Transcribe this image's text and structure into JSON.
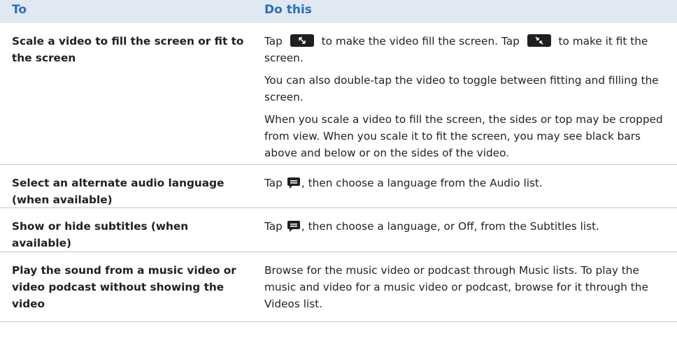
{
  "header": {
    "col_to": "To",
    "col_do": "Do this"
  },
  "rows": [
    {
      "to": "Scale a video to fill the screen or fit to the screen",
      "p1_a": "Tap",
      "p1_b": "to make the video fill the screen. Tap",
      "p1_c": "to make it fit the screen.",
      "p2": "You can also double-tap the video to toggle between fitting and filling the screen.",
      "p3": "When you scale a video to fill the screen, the sides or top may be cropped from view. When you scale it to fit the screen, you may see black bars above and below or on the sides of the video."
    },
    {
      "to": "Select an alternate audio language (when available)",
      "p1_a": "Tap",
      "p1_b": ", then choose a language from the Audio list."
    },
    {
      "to": "Show or hide subtitles (when available)",
      "p1_a": "Tap",
      "p1_b": ", then choose a language, or Off, from the Subtitles list."
    },
    {
      "to": "Play the sound from a music video or video podcast without showing the video",
      "p1": "Browse for the music video or podcast through Music lists. To play the music and video for a music video or podcast, browse for it through the Videos list."
    }
  ],
  "icons": {
    "fill": "scale-fill-icon",
    "fit": "scale-fit-icon",
    "audio_subtitles": "audio-subtitles-bubble-icon"
  },
  "colors": {
    "header_bg": "#dfe8f3",
    "header_text": "#2a6fb6",
    "rule": "#b9c7d6"
  }
}
